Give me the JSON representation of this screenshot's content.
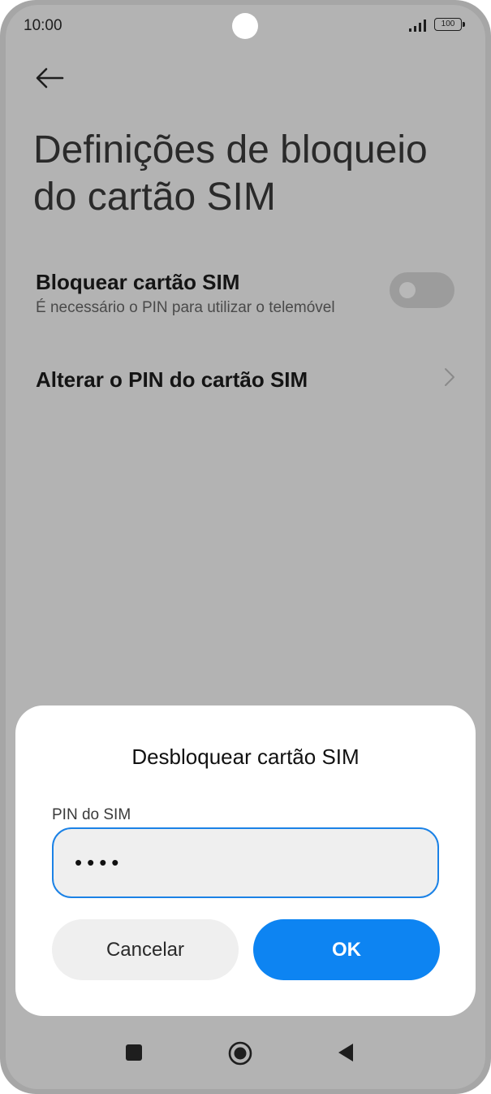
{
  "status_bar": {
    "time": "10:00",
    "battery": "100"
  },
  "header": {
    "title": "Definições de bloqueio do cartão SIM"
  },
  "settings": {
    "lock_sim": {
      "title": "Bloquear cartão SIM",
      "subtitle": "É necessário o PIN para utilizar o telemóvel",
      "enabled": false
    },
    "change_pin": {
      "title": "Alterar o PIN do cartão SIM"
    }
  },
  "dialog": {
    "title": "Desbloquear cartão SIM",
    "field_label": "PIN do SIM",
    "field_value": "••••",
    "cancel_label": "Cancelar",
    "ok_label": "OK"
  },
  "icons": {
    "back": "arrow-left-icon",
    "chevron": "chevron-right-icon",
    "nav_recents": "square-icon",
    "nav_home": "circle-icon",
    "nav_back": "triangle-left-icon"
  },
  "colors": {
    "accent": "#0d84f2",
    "dim_overlay": "#b3b3b3"
  }
}
